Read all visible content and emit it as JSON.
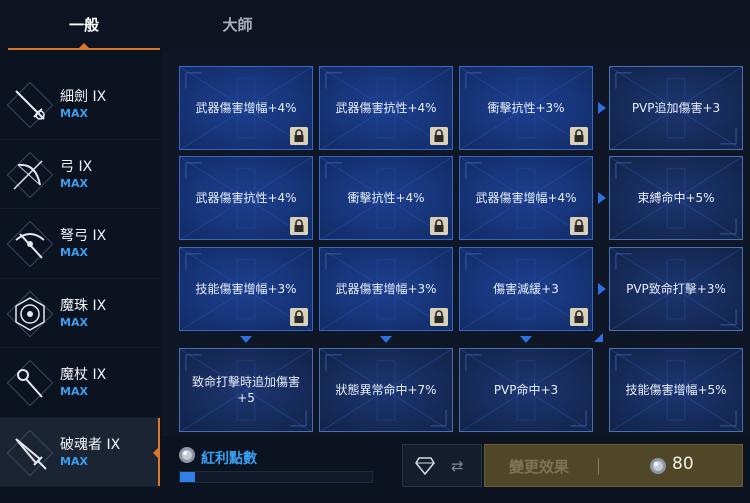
{
  "tabs": {
    "general": "一般",
    "master": "大師"
  },
  "weapons": [
    {
      "name": "細劍 IX",
      "level": "MAX",
      "icon": "rapier-icon"
    },
    {
      "name": "弓 IX",
      "level": "MAX",
      "icon": "bow-icon"
    },
    {
      "name": "弩弓 IX",
      "level": "MAX",
      "icon": "crossbow-icon"
    },
    {
      "name": "魔珠 IX",
      "level": "MAX",
      "icon": "orb-icon"
    },
    {
      "name": "魔杖 IX",
      "level": "MAX",
      "icon": "wand-icon"
    },
    {
      "name": "破魂者 IX",
      "level": "MAX",
      "icon": "soulbreaker-sword-icon"
    }
  ],
  "grid": {
    "rows": [
      [
        "武器傷害增幅+4%",
        "武器傷害抗性+4%",
        "衝擊抗性+3%",
        "PVP追加傷害+3"
      ],
      [
        "武器傷害抗性+4%",
        "衝擊抗性+4%",
        "武器傷害增幅+4%",
        "束縛命中+5%"
      ],
      [
        "技能傷害增幅+3%",
        "武器傷害增幅+3%",
        "傷害減緩+3",
        "PVP致命打擊+3%"
      ],
      [
        "致命打擊時追加傷害+5",
        "狀態異常命中+7%",
        "PVP命中+3",
        "技能傷害增幅+5%"
      ]
    ],
    "locked": [
      [
        true,
        true,
        true,
        false
      ],
      [
        true,
        true,
        true,
        false
      ],
      [
        true,
        true,
        true,
        false
      ],
      [
        false,
        false,
        false,
        false
      ]
    ]
  },
  "bonus": {
    "label": "紅利點數",
    "progress": 0.08
  },
  "action": {
    "label": "變更效果",
    "cost": "80",
    "swap_symbol": "⇄"
  },
  "colors": {
    "accent": "#d9772b",
    "blue": "#3aa0f2",
    "cell": "#17357a"
  }
}
